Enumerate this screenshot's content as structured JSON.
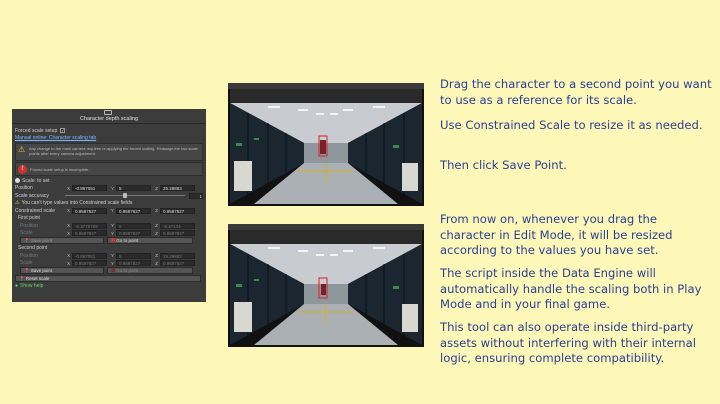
{
  "inspector": {
    "title": "Character depth scaling",
    "forced_scale_setup_label": "Forced scale setup",
    "forced_scale_setup_checked": "✓",
    "manual_link": "Manual online: Character scaling tab",
    "warning_text": "Any change to the main camera requires re-applying the forced scaling. Reassign the two scale points after every camera adjustment.",
    "error_text": "Forced scale setup is incomplete.",
    "scale_to_set_label": "Scale: to set",
    "position_label": "Position",
    "position": {
      "x": "-0.867051",
      "y": "5",
      "z": "25.28883"
    },
    "scale_accuracy_label": "Scale accuracy",
    "scale_accuracy_value": "1",
    "constrained_warning": "You can't type values into Constrained scale fields",
    "constrained_scale_label": "Constrained scale",
    "constrained_scale": {
      "x": "0.9587827",
      "y": "0.9587827",
      "z": "0.9587827"
    },
    "first_point": {
      "label": "First point",
      "position_label": "Position",
      "position": {
        "x": "-0.3778768",
        "y": "5",
        "z": "-8.47134"
      },
      "scale_label": "Scale",
      "scale": {
        "x": "0.9587827",
        "y": "0.9587827",
        "z": "0.9587827"
      },
      "save_label": "Save point",
      "goto_label": "Go to point"
    },
    "second_point": {
      "label": "Second point",
      "position_label": "Position",
      "position": {
        "x": "-0.867051",
        "y": "5",
        "z": "25.28883"
      },
      "scale_label": "Scale",
      "scale": {
        "x": "0.9587827",
        "y": "0.9587827",
        "z": "0.9587827"
      },
      "save_label": "Save point",
      "goto_label": "Go to point"
    },
    "reset_label": "Reset scale",
    "show_help_label": "Show help"
  },
  "instructions": {
    "p1": "Drag the character to a second point you want to use as a reference for its scale.",
    "p2": "Use Constrained Scale to resize it as needed.",
    "p3": "Then click Save Point.",
    "p4": "From now on, whenever you drag the character in Edit Mode, it will be resized according to the values you have set.",
    "p5": "The script inside the Data Engine will automatically handle the scaling both in Play Mode and in your final game.",
    "p6": "This tool can also operate inside third-party assets without interfering with their internal logic, ensuring complete compatibility."
  },
  "colors": {
    "background": "#fdf8b8",
    "text": "#2a3f96",
    "panel": "#3c3c3c",
    "error": "#d23030",
    "warning": "#f0c030"
  }
}
